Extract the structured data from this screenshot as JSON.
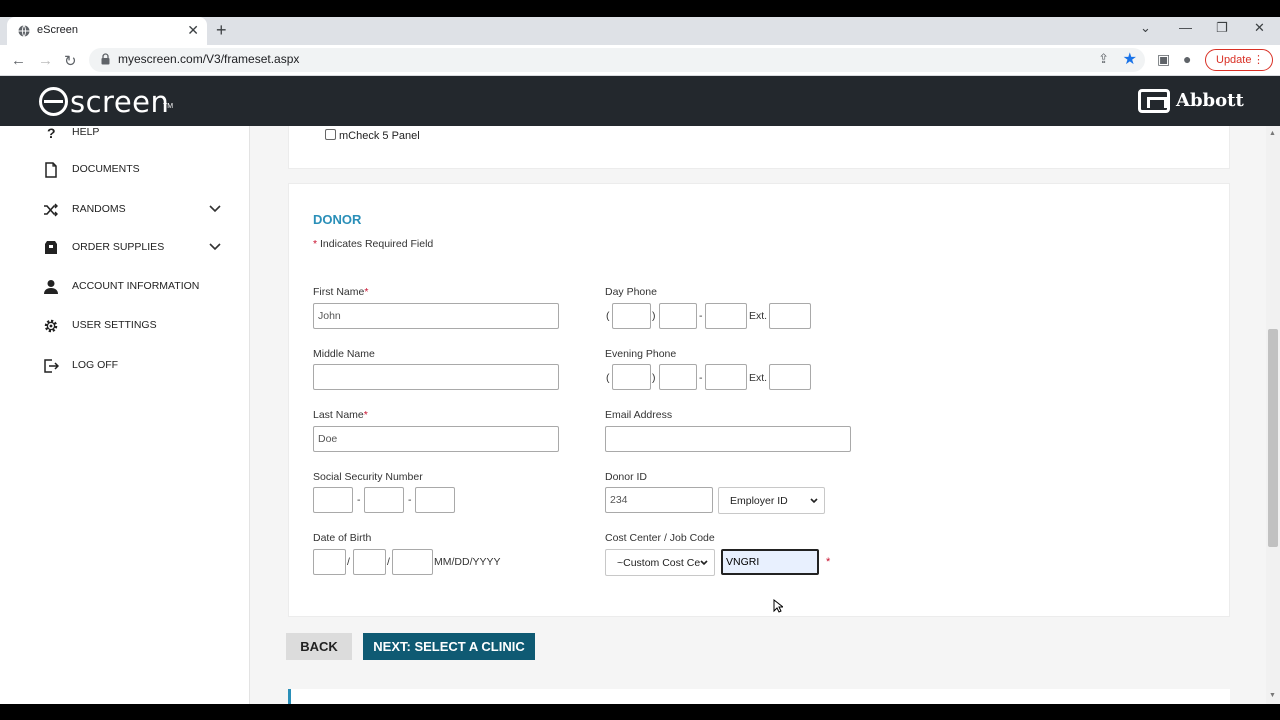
{
  "browser": {
    "tab_title": "eScreen",
    "url": "myescreen.com/V3/frameset.aspx",
    "update_label": "Update"
  },
  "header": {
    "logo_text": "escreen",
    "logo_tm": "TM",
    "partner": "Abbott"
  },
  "sidebar": {
    "items": [
      {
        "label": "HELP",
        "icon": "question-icon"
      },
      {
        "label": "DOCUMENTS",
        "icon": "document-icon"
      },
      {
        "label": "RANDOMS",
        "icon": "shuffle-icon",
        "expandable": true
      },
      {
        "label": "ORDER SUPPLIES",
        "icon": "box-icon",
        "expandable": true
      },
      {
        "label": "ACCOUNT INFORMATION",
        "icon": "user-icon"
      },
      {
        "label": "USER SETTINGS",
        "icon": "gear-icon"
      },
      {
        "label": "LOG OFF",
        "icon": "logout-icon"
      }
    ]
  },
  "tests": {
    "mcheck_label": "mCheck 5 Panel",
    "mcheck_checked": false
  },
  "donor": {
    "heading": "DONOR",
    "required_asterisk": "*",
    "required_note": "Indicates Required Field",
    "first_name": {
      "label": "First Name",
      "value": "John"
    },
    "middle_name": {
      "label": "Middle Name",
      "value": ""
    },
    "last_name": {
      "label": "Last Name",
      "value": "Doe"
    },
    "ssn": {
      "label": "Social Security Number",
      "sep": "-"
    },
    "dob": {
      "label": "Date of Birth",
      "sep": "/",
      "format_hint": "MM/DD/YYYY"
    },
    "day_phone": {
      "label": "Day Phone",
      "open": "(",
      "close": ")",
      "dash": "-",
      "ext_label": "Ext."
    },
    "evening_phone": {
      "label": "Evening Phone",
      "open": "(",
      "close": ")",
      "dash": "-",
      "ext_label": "Ext."
    },
    "email": {
      "label": "Email Address",
      "value": ""
    },
    "donor_id": {
      "label": "Donor ID",
      "value": "234",
      "type_selected": "Employer ID"
    },
    "cost_center": {
      "label": "Cost Center / Job Code",
      "selected": "~Custom Cost Ce",
      "value": "VNGRI"
    }
  },
  "actions": {
    "back": "BACK",
    "next": "NEXT: SELECT A CLINIC"
  },
  "colors": {
    "header_bg": "#23282d",
    "accent_blue": "#2a8fb8",
    "next_button": "#0f5a73",
    "required_red": "#c8102e"
  }
}
